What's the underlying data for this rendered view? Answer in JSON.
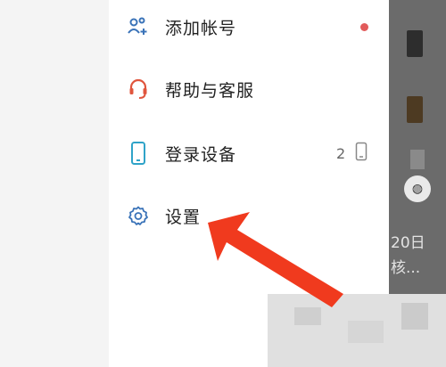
{
  "menu": {
    "items": [
      {
        "id": "add-account",
        "label": "添加帐号",
        "icon": "add-user-icon"
      },
      {
        "id": "help",
        "label": "帮助与客服",
        "icon": "headset-icon"
      },
      {
        "id": "login-devices",
        "label": "登录设备",
        "icon": "phone-icon",
        "count": "2"
      },
      {
        "id": "settings",
        "label": "设置",
        "icon": "gear-icon"
      }
    ]
  },
  "peek": {
    "date_text": "20日",
    "sub_text": "核..."
  },
  "colors": {
    "accent_blue": "#3a73b8",
    "help_red": "#e0553d",
    "notify_dot": "#e25b5b",
    "arrow_red": "#f03a1e"
  }
}
